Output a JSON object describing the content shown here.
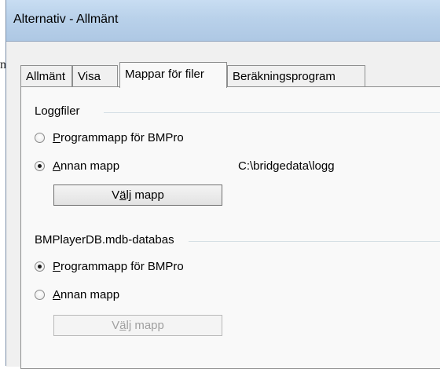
{
  "background": {
    "letter": "n"
  },
  "window": {
    "title": "Alternativ - Allmänt"
  },
  "tabs": [
    {
      "label": "Allmänt",
      "active": false
    },
    {
      "label": "Visa",
      "active": false
    },
    {
      "label": "Mappar för filer",
      "active": true
    },
    {
      "label": "Beräkningsprogram",
      "active": false
    }
  ],
  "loggfiler": {
    "group_label": "Loggfiler",
    "option_program": {
      "mnemonic": "P",
      "rest": "rogrammapp för BMPro",
      "checked": false
    },
    "option_other": {
      "mnemonic": "A",
      "rest": "nnan mapp",
      "checked": true
    },
    "path": "C:\\bridgedata\\logg",
    "choose_button": {
      "before": "V",
      "mnemonic": "ä",
      "after": "lj mapp",
      "enabled": true
    }
  },
  "database": {
    "group_label": "BMPlayerDB.mdb-databas",
    "option_program": {
      "mnemonic": "P",
      "rest": "rogrammapp för BMPro",
      "checked": true
    },
    "option_other": {
      "mnemonic": "A",
      "rest": "nnan mapp",
      "checked": false
    },
    "choose_button": {
      "before": "V",
      "mnemonic": "ä",
      "after": "lj mapp",
      "enabled": false
    }
  }
}
